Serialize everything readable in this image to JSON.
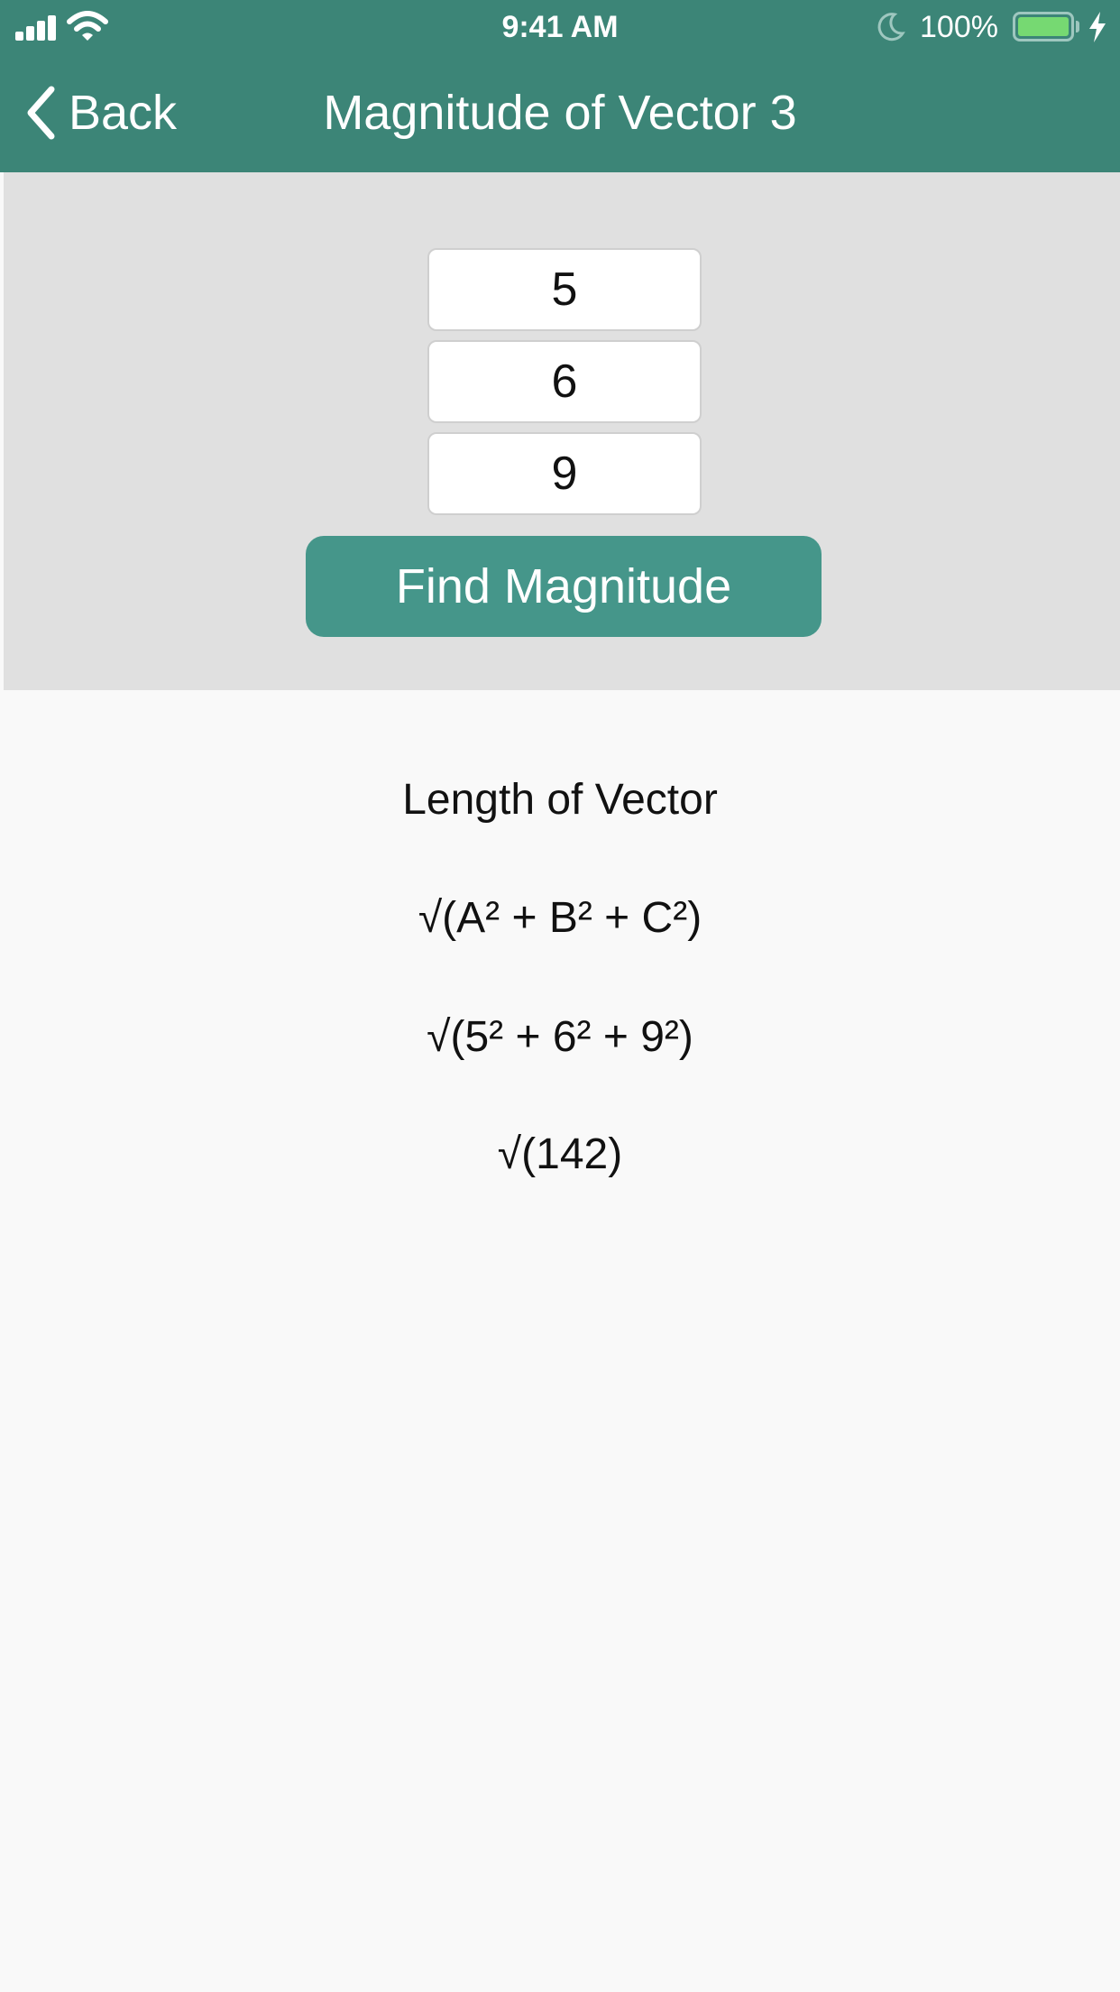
{
  "status_bar": {
    "time": "9:41 AM",
    "battery_percent": "100%",
    "battery_level": 1.0,
    "icons": [
      "signal-icon",
      "wifi-icon",
      "moon-icon",
      "battery-icon",
      "charging-bolt-icon"
    ]
  },
  "nav": {
    "back_label": "Back",
    "title": "Magnitude of Vector 3"
  },
  "inputs": {
    "a": "5",
    "b": "6",
    "c": "9"
  },
  "find_button_label": "Find Magnitude",
  "results": {
    "title": "Length of Vector",
    "formula": "√(A² + B² + C²)",
    "substituted": "√(5² + 6² + 9²)",
    "sum": "√(142)"
  },
  "colors": {
    "header": "#3c8577",
    "button": "#45968a",
    "panel": "#e0e0e0",
    "background": "#f9f9f9"
  }
}
